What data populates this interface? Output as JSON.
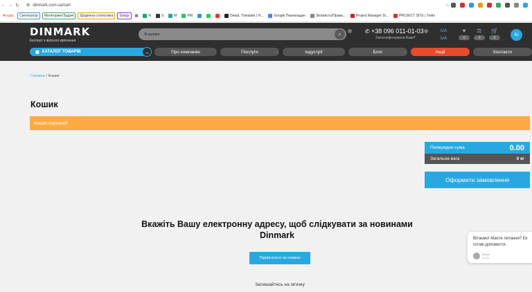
{
  "browser": {
    "url": "dinmark.com.ua/cart",
    "bookmarks": [
      "AI курс",
      "Синтезатор",
      "Моніторинг/Задачі",
      "Щоденна статистика",
      "Songs",
      "R",
      "S",
      "M",
      "PM",
      "DeepL Translate | H...",
      "Google Перекладач",
      "Зв'язність/Прави...",
      "Project Manager St...",
      "PROJECT SITE | Trello"
    ]
  },
  "header": {
    "logo": "DINMARK",
    "tagline": "Експерт з якісного кріплення",
    "search_placeholder": "Я шукаю",
    "phone": "+38 096 011-01-03",
    "callback": "Зателефонувати Вам?",
    "lang_1": "UA",
    "lang_2": "UA",
    "wishlist_count": "0",
    "compare_count": "0",
    "cart_count": "0",
    "user_initials": "Ю"
  },
  "nav": {
    "catalog": "КАТАЛОГ ТОВАРІВ",
    "items": [
      "Про компанію",
      "Послуги",
      "Індустрії",
      "Блог",
      "Акції",
      "Контакти"
    ]
  },
  "breadcrumb": {
    "home": "Головна",
    "separator": "/",
    "current": "Кошик"
  },
  "page_title": "Кошик",
  "empty_message": "Кошик порожній",
  "summary": {
    "prev_label": "Попередня сума",
    "prev_value": "0.00",
    "weight_label": "Загальна вага",
    "weight_value": "0 кг",
    "order_button": "Оформити замовлення"
  },
  "subscribe": {
    "title": "Вкажіть Вашу електронну адресу, щоб слідкувати за новинами Dinmark",
    "button": "Підписатися на новини",
    "stay_in_touch": "Залишайтесь на зв'язку"
  },
  "chat": {
    "message": "Вітаємо! Маєте питання? Ек готові допомогти.",
    "agent": "Марія",
    "time": "11:23"
  },
  "colors": {
    "accent": "#29a8e0",
    "promo": "#e84b2b",
    "empty_bar": "#fcab42",
    "header_bg": "#2f2f2f"
  }
}
